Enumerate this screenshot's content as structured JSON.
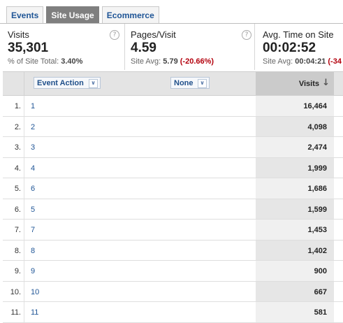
{
  "tabs": [
    {
      "label": "Events",
      "active": false
    },
    {
      "label": "Site Usage",
      "active": true
    },
    {
      "label": "Ecommerce",
      "active": false
    }
  ],
  "metrics": [
    {
      "name": "Visits",
      "value": "35,301",
      "sub_prefix": "% of Site Total:",
      "sub_value": "3.40%",
      "sub_delta": ""
    },
    {
      "name": "Pages/Visit",
      "value": "4.59",
      "sub_prefix": "Site Avg:",
      "sub_value": "5.79",
      "sub_delta": "(-20.66%)"
    },
    {
      "name": "Avg. Time on Site",
      "value": "00:02:52",
      "sub_prefix": "Site Avg:",
      "sub_value": "00:04:21",
      "sub_delta": "(-34"
    }
  ],
  "table": {
    "dimension_primary": "Event Action",
    "dimension_secondary": "None",
    "metric_header": "Visits",
    "rows": [
      {
        "index": "1.",
        "label": "1",
        "visits": "16,464"
      },
      {
        "index": "2.",
        "label": "2",
        "visits": "4,098"
      },
      {
        "index": "3.",
        "label": "3",
        "visits": "2,474"
      },
      {
        "index": "4.",
        "label": "4",
        "visits": "1,999"
      },
      {
        "index": "5.",
        "label": "6",
        "visits": "1,686"
      },
      {
        "index": "6.",
        "label": "5",
        "visits": "1,599"
      },
      {
        "index": "7.",
        "label": "7",
        "visits": "1,453"
      },
      {
        "index": "8.",
        "label": "8",
        "visits": "1,402"
      },
      {
        "index": "9.",
        "label": "9",
        "visits": "900"
      },
      {
        "index": "10.",
        "label": "10",
        "visits": "667"
      },
      {
        "index": "11.",
        "label": "11",
        "visits": "581"
      }
    ]
  },
  "icons": {
    "help": "help-icon",
    "chevron": "chevron-down-icon",
    "sort": "sort-descending-icon"
  },
  "colors": {
    "link": "#1f5596",
    "negative": "#b3000c",
    "active_tab": "#7f7f7f"
  }
}
